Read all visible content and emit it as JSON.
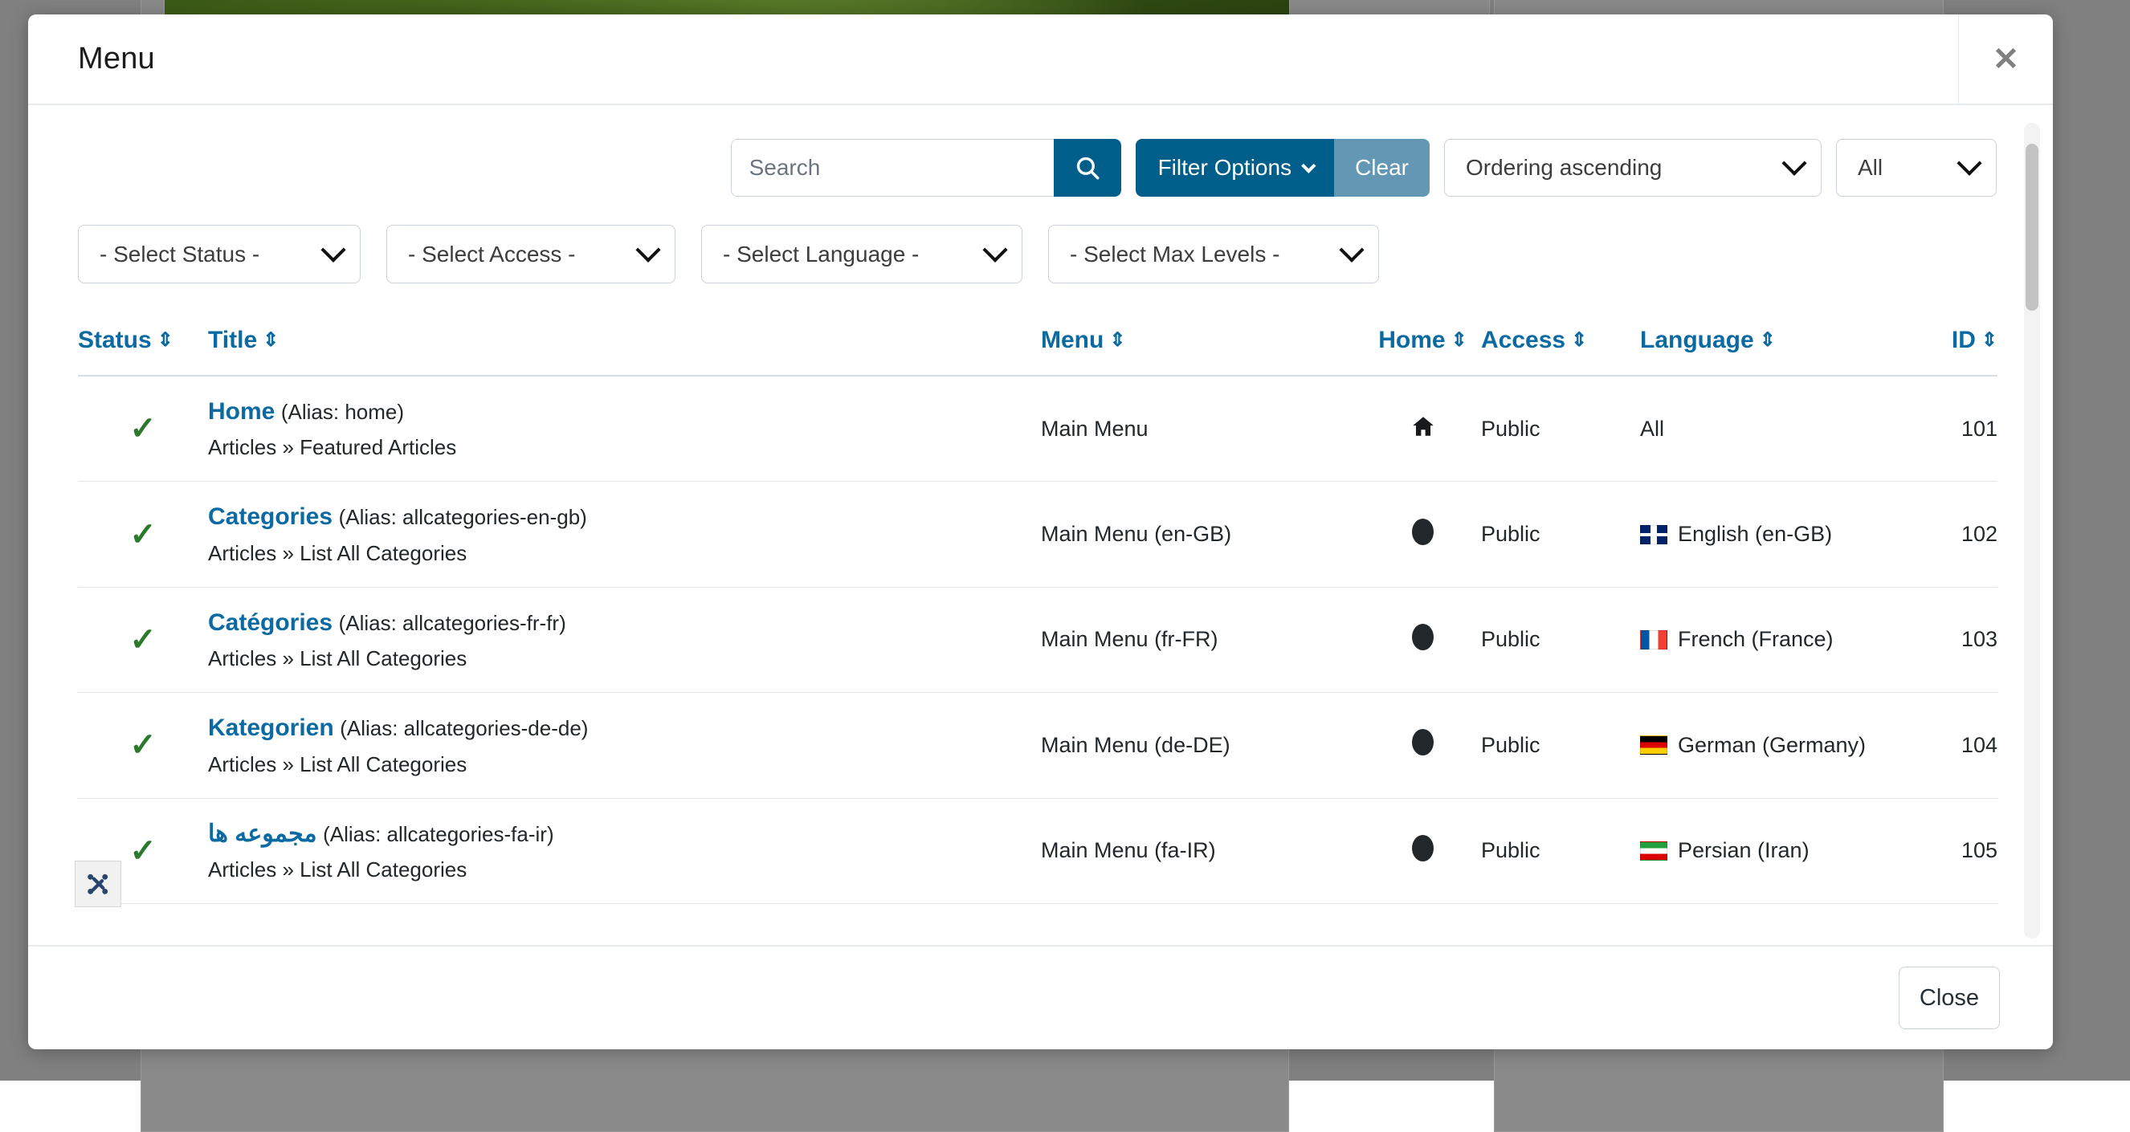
{
  "modal": {
    "title": "Menu",
    "close_icon": "close-icon",
    "close_button_label": "Close"
  },
  "toolbar": {
    "search": {
      "placeholder": "Search",
      "value": "",
      "button_icon": "search-icon"
    },
    "filter_options_label": "Filter Options",
    "filter_options_caret": "chevron-down-icon",
    "clear_label": "Clear",
    "ordering_value": "Ordering ascending",
    "limit_value": "All"
  },
  "filters": [
    {
      "name": "status",
      "value": "- Select Status -"
    },
    {
      "name": "access",
      "value": "- Select Access -"
    },
    {
      "name": "language",
      "value": "- Select Language -"
    },
    {
      "name": "maxlevels",
      "value": "- Select Max Levels -"
    }
  ],
  "table": {
    "columns": [
      {
        "key": "status",
        "label": "Status"
      },
      {
        "key": "title",
        "label": "Title"
      },
      {
        "key": "menu",
        "label": "Menu"
      },
      {
        "key": "home",
        "label": "Home"
      },
      {
        "key": "access",
        "label": "Access"
      },
      {
        "key": "language",
        "label": "Language"
      },
      {
        "key": "id",
        "label": "ID"
      }
    ],
    "sort_icon": "sort-updown-icon",
    "rows": [
      {
        "status": "published",
        "status_icon": "check-icon",
        "title": "Home",
        "alias": "(Alias: home)",
        "path": "Articles » Featured Articles",
        "menu": "Main Menu",
        "home": "yes",
        "home_icon": "home-icon",
        "access": "Public",
        "language": "All",
        "flag": "none",
        "id": "101"
      },
      {
        "status": "published",
        "status_icon": "check-icon",
        "title": "Categories",
        "alias": "(Alias: allcategories-en-gb)",
        "path": "Articles » List All Categories",
        "menu": "Main Menu (en-GB)",
        "home": "no",
        "home_icon": "dot-icon",
        "access": "Public",
        "language": "English (en-GB)",
        "flag": "gb",
        "id": "102"
      },
      {
        "status": "published",
        "status_icon": "check-icon",
        "title": "Catégories",
        "alias": "(Alias: allcategories-fr-fr)",
        "path": "Articles » List All Categories",
        "menu": "Main Menu (fr-FR)",
        "home": "no",
        "home_icon": "dot-icon",
        "access": "Public",
        "language": "French (France)",
        "flag": "fr",
        "id": "103"
      },
      {
        "status": "published",
        "status_icon": "check-icon",
        "title": "Kategorien",
        "alias": "(Alias: allcategories-de-de)",
        "path": "Articles » List All Categories",
        "menu": "Main Menu (de-DE)",
        "home": "no",
        "home_icon": "dot-icon",
        "access": "Public",
        "language": "German (Germany)",
        "flag": "de",
        "id": "104"
      },
      {
        "status": "published",
        "status_icon": "check-icon",
        "title": "مجموعه ها",
        "alias": "(Alias: allcategories-fa-ir)",
        "path": "Articles » List All Categories",
        "menu": "Main Menu (fa-IR)",
        "home": "no",
        "home_icon": "dot-icon",
        "access": "Public",
        "language": "Persian (Iran)",
        "flag": "ir",
        "id": "105"
      }
    ]
  },
  "badge": {
    "icon": "joomla-logo-icon"
  },
  "colors": {
    "primary": "#005e8a",
    "primary_light": "#6397b4",
    "link": "#0a6aa1",
    "published_green": "#2b7a2b",
    "border": "#ccd2d9",
    "backdrop": "#808080"
  }
}
